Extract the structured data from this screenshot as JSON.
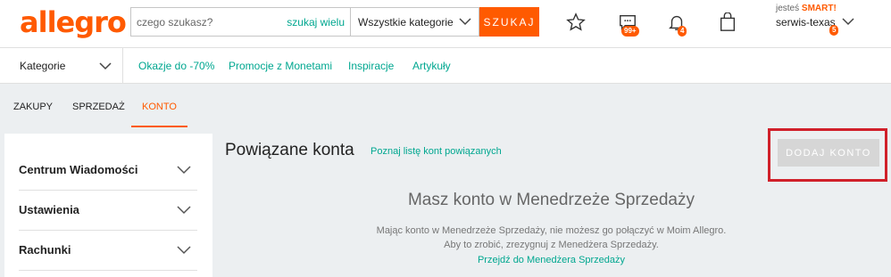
{
  "header": {
    "logo": "allegro",
    "search_placeholder": "czego szukasz?",
    "search_many": "szukaj wielu",
    "category": "Wszystkie kategorie",
    "search_button": "SZUKAJ",
    "messages_badge": "99+",
    "notifications_badge": "4",
    "smart_prefix": "jesteś",
    "smart_label": "SMART!",
    "username": "serwis-texas",
    "user_badge": "5"
  },
  "nav": {
    "categories": "Kategorie",
    "links": [
      "Okazje do -70%",
      "Promocje z Monetami",
      "Inspiracje",
      "Artykuły"
    ]
  },
  "tabs": [
    "ZAKUPY",
    "SPRZEDAŻ",
    "KONTO"
  ],
  "active_tab": "KONTO",
  "sidebar": {
    "items": [
      "Centrum Wiadomości",
      "Ustawienia",
      "Rachunki"
    ]
  },
  "main": {
    "title": "Powiązane konta",
    "title_link": "Poznaj listę kont powiązanych",
    "add_button": "DODAJ KONTO",
    "heading": "Masz konto w Menedrzeże Sprzedaży",
    "desc_line1": "Mając konto w Menedrzeże Sprzedaży, nie możesz go połączyć w Moim Allegro.",
    "desc_line2": "Aby to zrobić, zrezygnuj z Menedżera Sprzedaży.",
    "goto_link": "Przejdź do Menedżera Sprzedaży"
  },
  "colors": {
    "brand": "#ff5a00",
    "link": "#00a790",
    "highlight": "#d0202a"
  }
}
